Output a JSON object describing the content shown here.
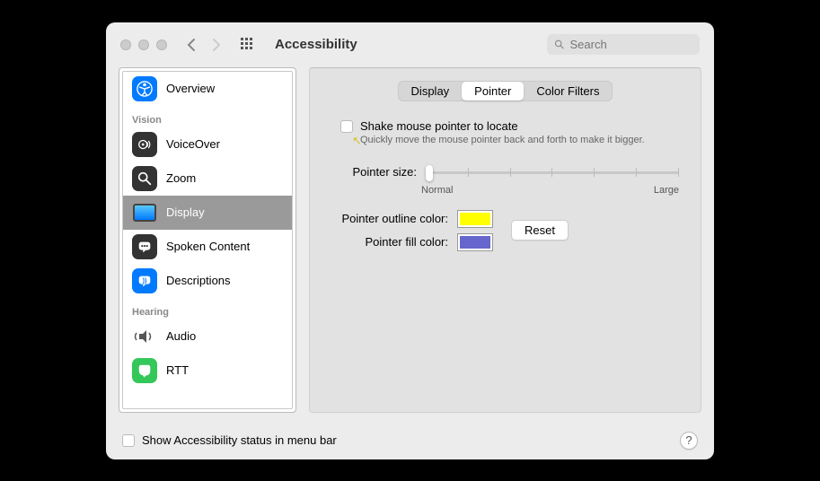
{
  "window": {
    "title": "Accessibility"
  },
  "search": {
    "placeholder": "Search"
  },
  "sidebar": {
    "sections": {
      "top": [
        {
          "label": "Overview"
        }
      ],
      "vision_header": "Vision",
      "vision": [
        {
          "label": "VoiceOver"
        },
        {
          "label": "Zoom"
        },
        {
          "label": "Display"
        },
        {
          "label": "Spoken Content"
        },
        {
          "label": "Descriptions"
        }
      ],
      "hearing_header": "Hearing",
      "hearing": [
        {
          "label": "Audio"
        },
        {
          "label": "RTT"
        }
      ]
    }
  },
  "tabs": {
    "display": "Display",
    "pointer": "Pointer",
    "color_filters": "Color Filters",
    "active": "pointer"
  },
  "pointer": {
    "shake_label": "Shake mouse pointer to locate",
    "shake_desc": "Quickly move the mouse pointer back and forth to make it bigger.",
    "size_label": "Pointer size:",
    "size_min": "Normal",
    "size_max": "Large",
    "outline_label": "Pointer outline color:",
    "fill_label": "Pointer fill color:",
    "outline_color": "#ffff00",
    "fill_color": "#6666cc",
    "reset_label": "Reset"
  },
  "footer": {
    "status_label": "Show Accessibility status in menu bar",
    "help": "?"
  }
}
